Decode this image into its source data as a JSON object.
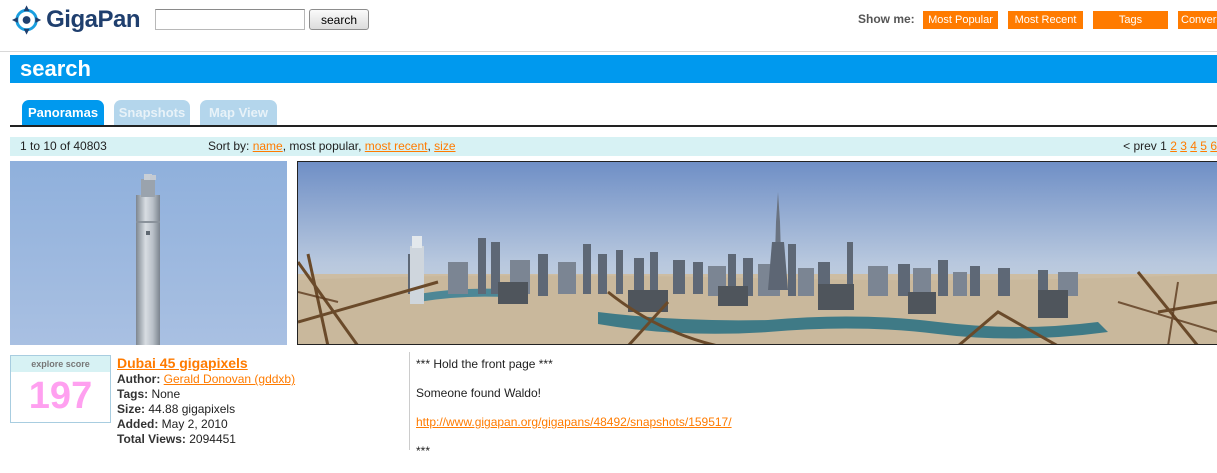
{
  "header": {
    "logo_text": "GigaPan",
    "search_placeholder": "",
    "search_value": "",
    "search_button": "search",
    "show_me_label": "Show me:",
    "show_me_buttons": [
      "Most Popular",
      "Most Recent",
      "Tags",
      "Conversations"
    ]
  },
  "page_title": "search",
  "tabs": [
    {
      "label": "Panoramas",
      "active": true
    },
    {
      "label": "Snapshots",
      "active": false
    },
    {
      "label": "Map View",
      "active": false
    }
  ],
  "results": {
    "count_text": "1 to 10 of 40803",
    "sort_label": "Sort by:",
    "sort_options": [
      {
        "label": "name",
        "link": true
      },
      {
        "label": "most popular",
        "link": false
      },
      {
        "label": "most recent",
        "link": true
      },
      {
        "label": "size",
        "link": true
      }
    ],
    "pager_prev": "< prev",
    "pager_current": "1",
    "pager_pages": [
      "2",
      "3",
      "4",
      "5",
      "6"
    ]
  },
  "item": {
    "explore_score_label": "explore score",
    "score": "197",
    "title": "Dubai 45 gigapixels",
    "author_label": "Author:",
    "author": "Gerald Donovan (gddxb)",
    "tags_label": "Tags:",
    "tags": "None",
    "size_label": "Size:",
    "size": "44.88 gigapixels",
    "added_label": "Added:",
    "added": "May 2, 2010",
    "views_label": "Total Views:",
    "views": "2094451",
    "description": [
      "*** Hold the front page ***",
      "Someone found Waldo!"
    ],
    "description_link": "http://www.gigapan.org/gigapans/48492/snapshots/159517/",
    "description_more": "***"
  },
  "colors": {
    "accent_blue": "#0099ee",
    "accent_orange": "#ff7b00",
    "info_bar": "#d7f2f4",
    "score_pink": "#ffa0f0"
  },
  "icons": [
    "gigapan-logo-icon"
  ]
}
